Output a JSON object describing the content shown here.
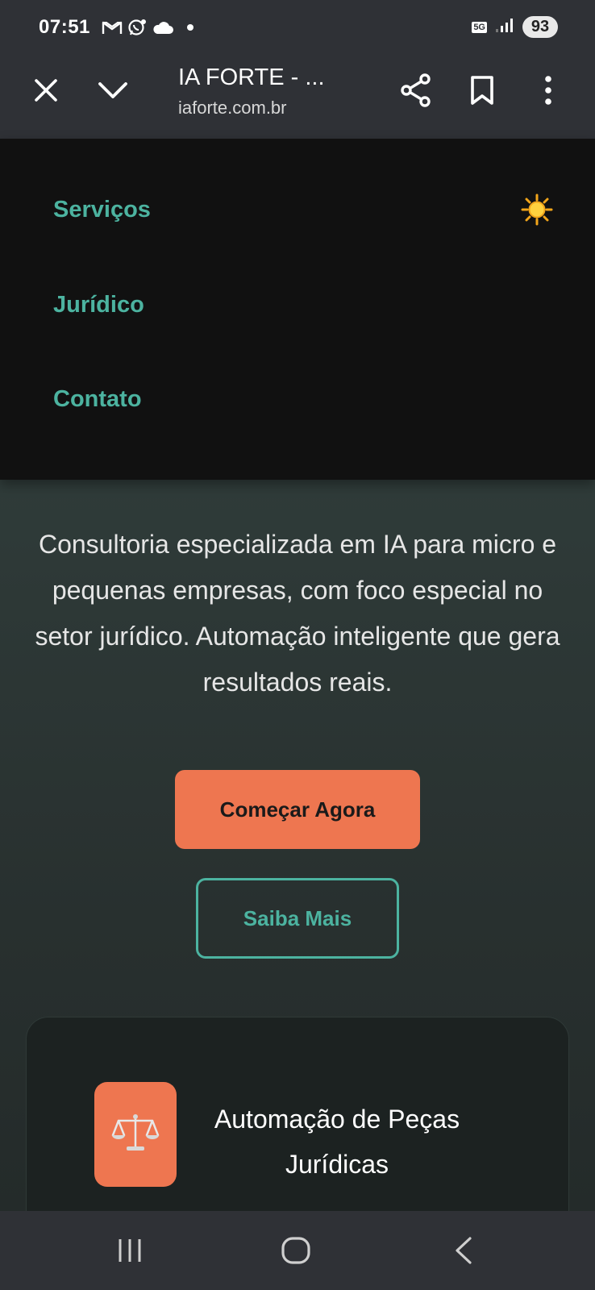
{
  "status_bar": {
    "time": "07:51",
    "network": "5G",
    "battery": "93",
    "icons": [
      "gmail-icon",
      "whatsapp-icon",
      "cloud-icon",
      "notification-dot"
    ]
  },
  "browser": {
    "page_title": "IA FORTE - ...",
    "url": "iaforte.com.br",
    "actions": [
      "close-icon",
      "chevron-down-icon",
      "share-icon",
      "bookmark-icon",
      "more-vert-icon"
    ]
  },
  "nav_menu": {
    "items": [
      {
        "label": "Serviços"
      },
      {
        "label": "Jurídico"
      },
      {
        "label": "Contato"
      }
    ],
    "theme_toggle_icon": "sun-icon"
  },
  "hero": {
    "description": "Consultoria especializada em IA para micro e pequenas empresas, com foco especial no setor jurídico. Automação inteligente que gera resultados reais.",
    "primary_button": "Começar Agora",
    "secondary_button": "Saiba Mais"
  },
  "service_card": {
    "icon": "scales-icon",
    "title": "Automação de Peças Jurídicas"
  },
  "colors": {
    "accent_teal": "#4cb3a0",
    "accent_orange": "#ee7650",
    "menu_bg": "#111111",
    "chrome_bg": "#2f3136"
  },
  "system_nav": [
    "recent-apps-icon",
    "home-icon",
    "back-icon"
  ]
}
